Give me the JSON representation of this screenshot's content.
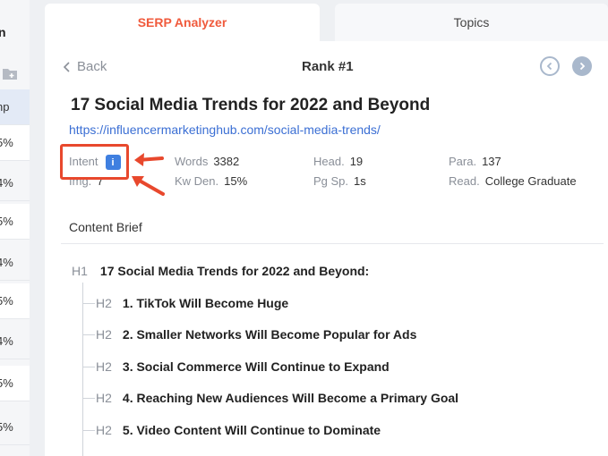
{
  "sidebar": {
    "title_fragment": "n",
    "folder_icon": "folder-plus-icon",
    "active_fragment": "np",
    "values": [
      "5%",
      "4%",
      "5%",
      "4%",
      "5%",
      "4%",
      "5%",
      "5%"
    ]
  },
  "tabs": [
    {
      "label": "SERP Analyzer",
      "active": true
    },
    {
      "label": "Topics",
      "active": false
    }
  ],
  "header": {
    "back_label": "Back",
    "rank_label": "Rank #1"
  },
  "result": {
    "title": "17 Social Media Trends for 2022 and Beyond",
    "url": "https://influencermarketinghub.com/social-media-trends/"
  },
  "stats": {
    "intent_label": "Intent",
    "intent_badge": "i",
    "img_label": "Img.",
    "img_value": "7",
    "words_label": "Words",
    "words_value": "3382",
    "kwden_label": "Kw Den.",
    "kwden_value": "15%",
    "head_label": "Head.",
    "head_value": "19",
    "pgsp_label": "Pg Sp.",
    "pgsp_value": "1s",
    "para_label": "Para.",
    "para_value": "137",
    "read_label": "Read.",
    "read_value": "College Graduate"
  },
  "content_brief": {
    "heading": "Content Brief",
    "outline": [
      {
        "tag": "H1",
        "text": "17 Social Media Trends for 2022 and Beyond:"
      },
      {
        "tag": "H2",
        "text": "1. TikTok Will Become Huge"
      },
      {
        "tag": "H2",
        "text": "2. Smaller Networks Will Become Popular for Ads"
      },
      {
        "tag": "H2",
        "text": "3. Social Commerce Will Continue to Expand"
      },
      {
        "tag": "H2",
        "text": "4. Reaching New Audiences Will Become a Primary Goal"
      },
      {
        "tag": "H2",
        "text": "5. Video Content Will Continue to Dominate"
      }
    ]
  },
  "colors": {
    "accent": "#f05a3c",
    "link": "#3b6fd4",
    "annotation": "#e8482d",
    "badge": "#3f7fe0"
  }
}
